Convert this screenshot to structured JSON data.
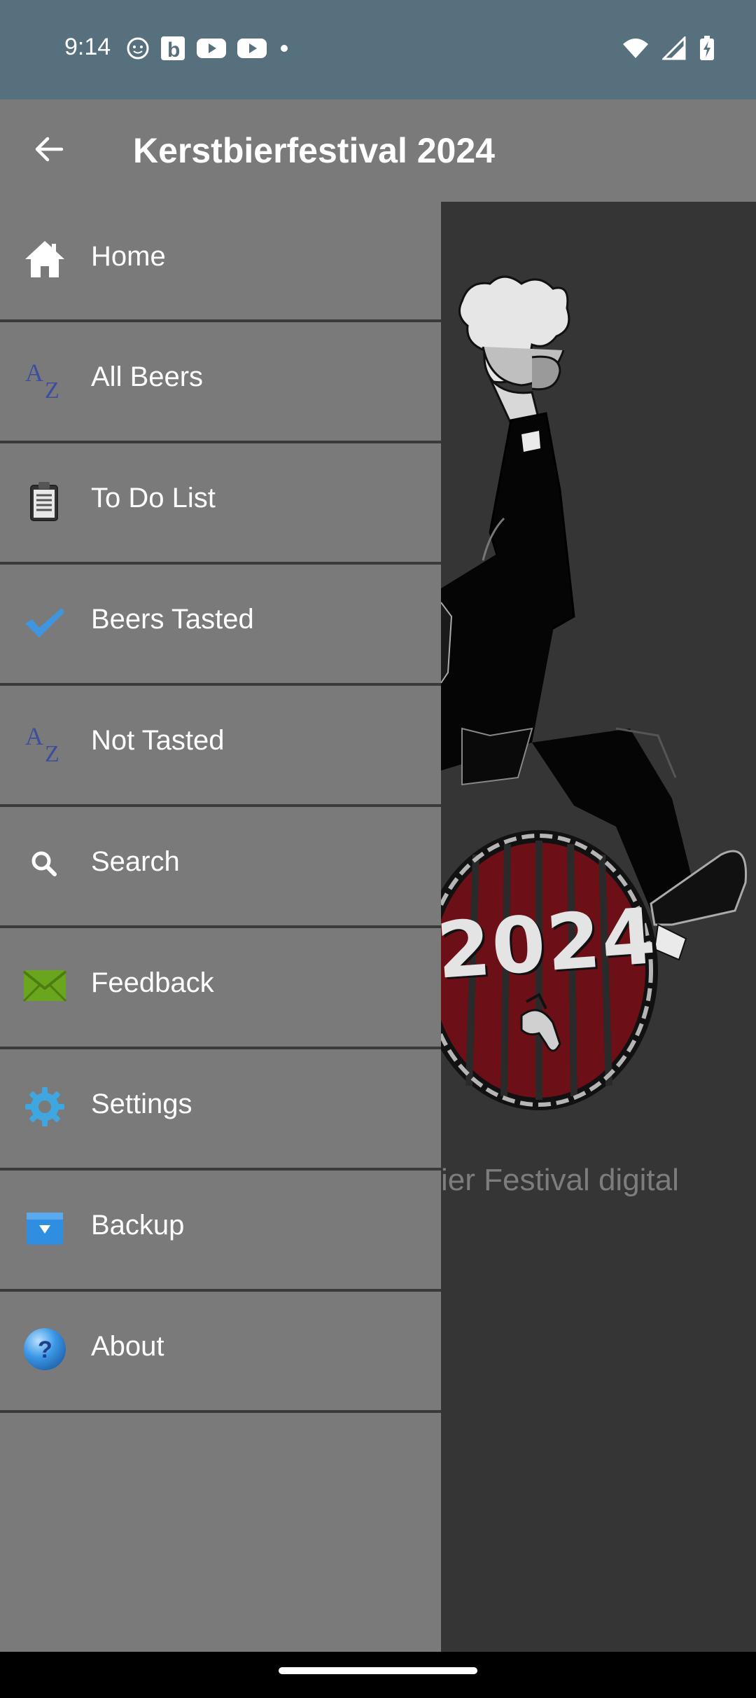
{
  "status": {
    "time": "9:14"
  },
  "app": {
    "title": "Kerstbierfestival 2024"
  },
  "drawer": {
    "items": [
      {
        "label": "Home",
        "icon": "home-icon"
      },
      {
        "label": "All Beers",
        "icon": "az-sort-icon"
      },
      {
        "label": "To Do List",
        "icon": "clipboard-icon"
      },
      {
        "label": "Beers Tasted",
        "icon": "checkmark-icon"
      },
      {
        "label": "Not Tasted",
        "icon": "az-sort-icon"
      },
      {
        "label": "Search",
        "icon": "search-icon"
      },
      {
        "label": "Feedback",
        "icon": "envelope-icon"
      },
      {
        "label": "Settings",
        "icon": "gear-icon"
      },
      {
        "label": "Backup",
        "icon": "backup-box-icon"
      },
      {
        "label": "About",
        "icon": "question-icon"
      }
    ]
  },
  "content": {
    "caption_partial": "ier Festival digital",
    "logo_year": "2024"
  },
  "colors": {
    "statusbar": "#56707e",
    "appbar": "#7a7a7a",
    "drawer": "#7a7a7a",
    "content": "#353535"
  }
}
